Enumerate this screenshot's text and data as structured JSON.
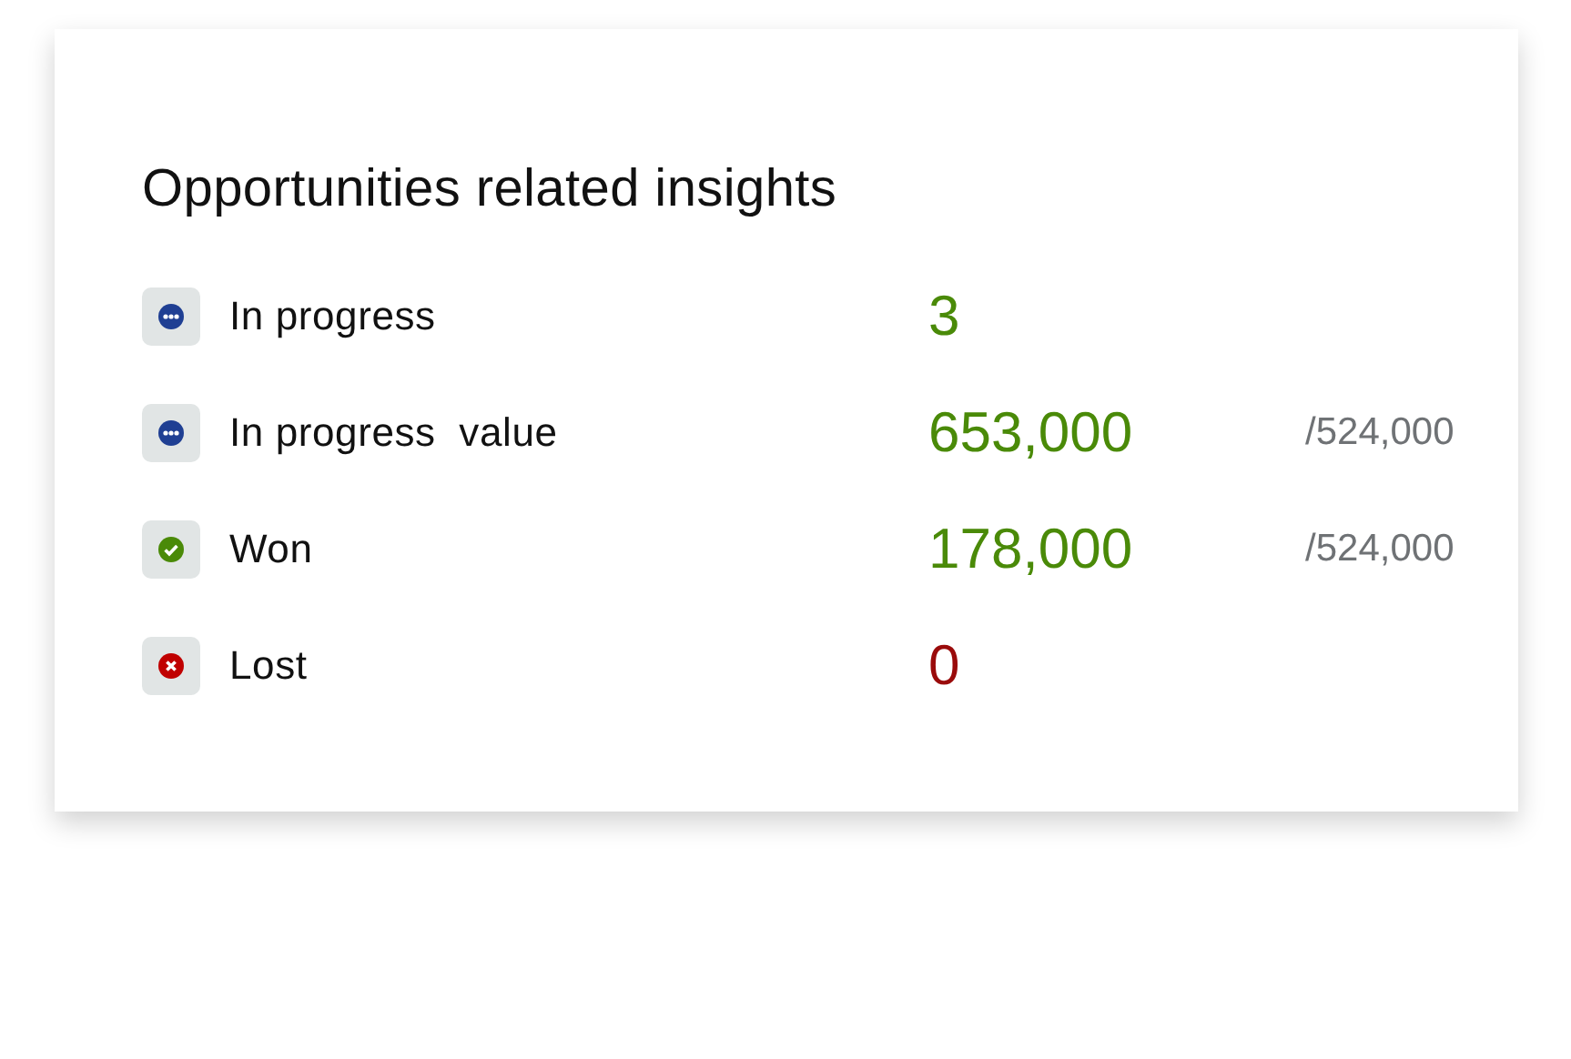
{
  "card": {
    "title": "Opportunities related insights",
    "rows": [
      {
        "kind": "in_progress",
        "label": "In progress",
        "value": "3"
      },
      {
        "kind": "in_progress",
        "label": "In progress  value",
        "value": "653,000",
        "target": "/524,000"
      },
      {
        "kind": "won",
        "label": "Won",
        "value": "178,000",
        "target": "/524,000"
      },
      {
        "kind": "lost",
        "label": "Lost",
        "value": "0"
      }
    ]
  }
}
